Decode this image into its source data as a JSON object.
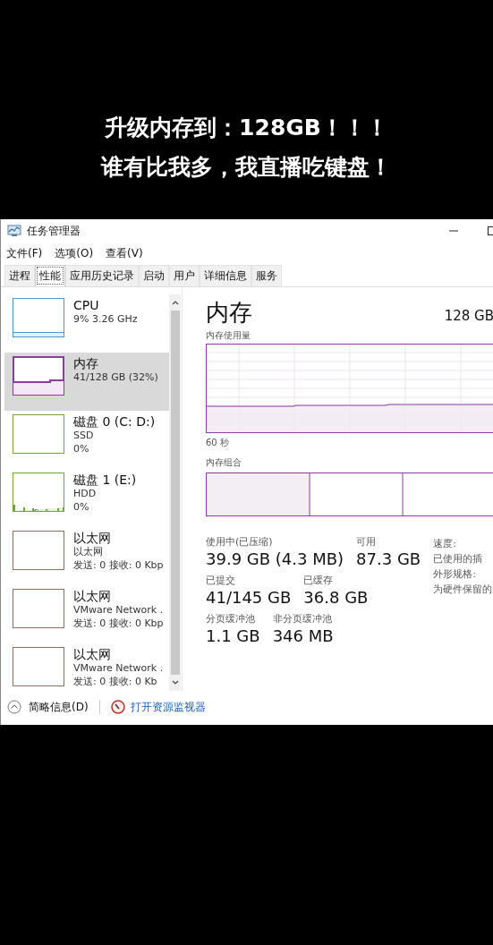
{
  "caption": [
    "升级内存到：128GB！！！",
    "谁有比我多，我直播吃键盘！"
  ],
  "window": {
    "title": "任务管理器"
  },
  "menu": [
    "文件(F)",
    "选项(O)",
    "查看(V)"
  ],
  "tabs": [
    {
      "label": "进程",
      "selected": false
    },
    {
      "label": "性能",
      "selected": true
    },
    {
      "label": "应用历史记录",
      "selected": false
    },
    {
      "label": "启动",
      "selected": false
    },
    {
      "label": "用户",
      "selected": false
    },
    {
      "label": "详细信息",
      "selected": false
    },
    {
      "label": "服务",
      "selected": false
    }
  ],
  "sidebar": {
    "items": [
      {
        "kind": "cpu",
        "color": "#4a9ac8",
        "selected": false,
        "name": "CPU",
        "lines": [
          "9% 3.26 GHz"
        ]
      },
      {
        "kind": "memory",
        "color": "#8b3a9e",
        "selected": true,
        "name": "内存",
        "lines": [
          "41/128 GB (32%)"
        ]
      },
      {
        "kind": "disk",
        "color": "#6fa83a",
        "selected": false,
        "name": "磁盘 0 (C: D:)",
        "lines": [
          "SSD",
          "0%"
        ]
      },
      {
        "kind": "disk-activity",
        "color": "#6fa83a",
        "selected": false,
        "name": "磁盘 1 (E:)",
        "lines": [
          "HDD",
          "0%"
        ]
      },
      {
        "kind": "network",
        "color": "#8b6f5a",
        "selected": false,
        "name": "以太网",
        "lines": [
          "以太网",
          "发送: 0 接收: 0 Kbp"
        ]
      },
      {
        "kind": "network",
        "color": "#8b6f5a",
        "selected": false,
        "name": "以太网",
        "lines": [
          "VMware Network .",
          "发送: 0 接收: 0 Kbp"
        ]
      },
      {
        "kind": "network",
        "color": "#8b6f5a",
        "selected": false,
        "name": "以太网",
        "lines": [
          "VMware Network .",
          "发送: 0 接收: 0 Kb"
        ]
      }
    ]
  },
  "detail": {
    "title": "内存",
    "total": "128 GB",
    "graph_label": "内存使用量",
    "graph_time": "60 秒",
    "composition_label": "内存组合",
    "stats": [
      [
        {
          "label": "使用中(已压缩)",
          "value": "39.9 GB (4.3 MB)"
        },
        {
          "label": "可用",
          "value": "87.3 GB"
        }
      ],
      [
        {
          "label": "已提交",
          "value": "41/145 GB"
        },
        {
          "label": "已缓存",
          "value": "36.8 GB"
        }
      ],
      [
        {
          "label": "分页缓冲池",
          "value": "1.1 GB"
        },
        {
          "label": "非分页缓冲池",
          "value": "346 MB"
        }
      ]
    ],
    "properties": [
      "速度:",
      "已使用的插",
      "外形规格:",
      "为硬件保留的"
    ]
  },
  "footer": {
    "summary": "简略信息(D)",
    "link": "打开资源监视器"
  }
}
